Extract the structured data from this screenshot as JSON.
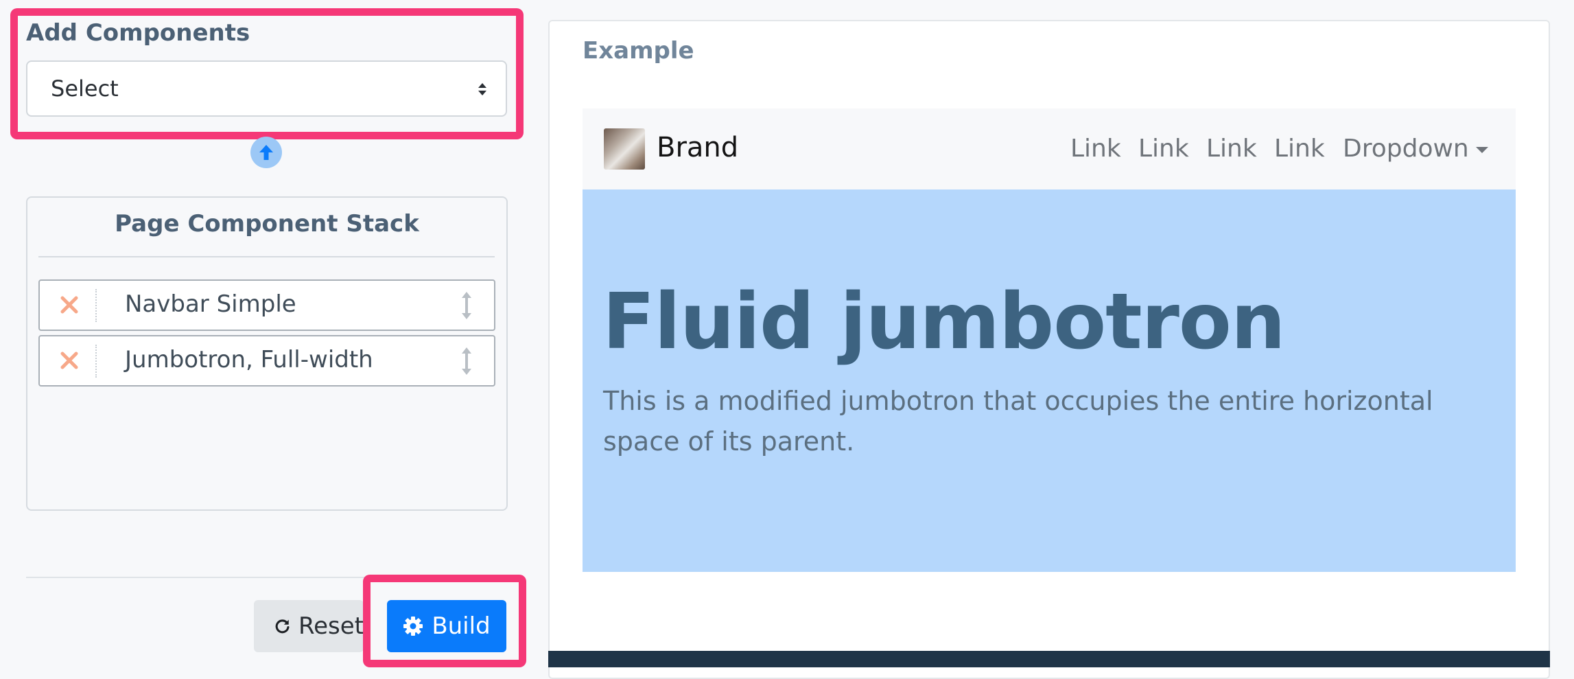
{
  "builder": {
    "add_components": {
      "title": "Add Components",
      "select_value": "Select"
    },
    "move_up_icon": "arrow-up-icon",
    "stack": {
      "title": "Page Component Stack",
      "items": [
        {
          "label": "Navbar Simple"
        },
        {
          "label": "Jumbotron, Full-width"
        }
      ]
    },
    "actions": {
      "reset_label": "Reset",
      "build_label": "Build"
    }
  },
  "preview": {
    "title": "Example",
    "navbar": {
      "brand": "Brand",
      "links": [
        "Link",
        "Link",
        "Link",
        "Link"
      ],
      "dropdown": "Dropdown"
    },
    "jumbotron": {
      "heading": "Fluid jumbotron",
      "text": "This is a modified jumbotron that occupies the entire horizontal space of its parent."
    }
  },
  "colors": {
    "highlight": "#f53877",
    "primary": "#0a7bfb",
    "jumbotron_bg": "#b5d7fc",
    "remove_x": "#f7a889"
  }
}
